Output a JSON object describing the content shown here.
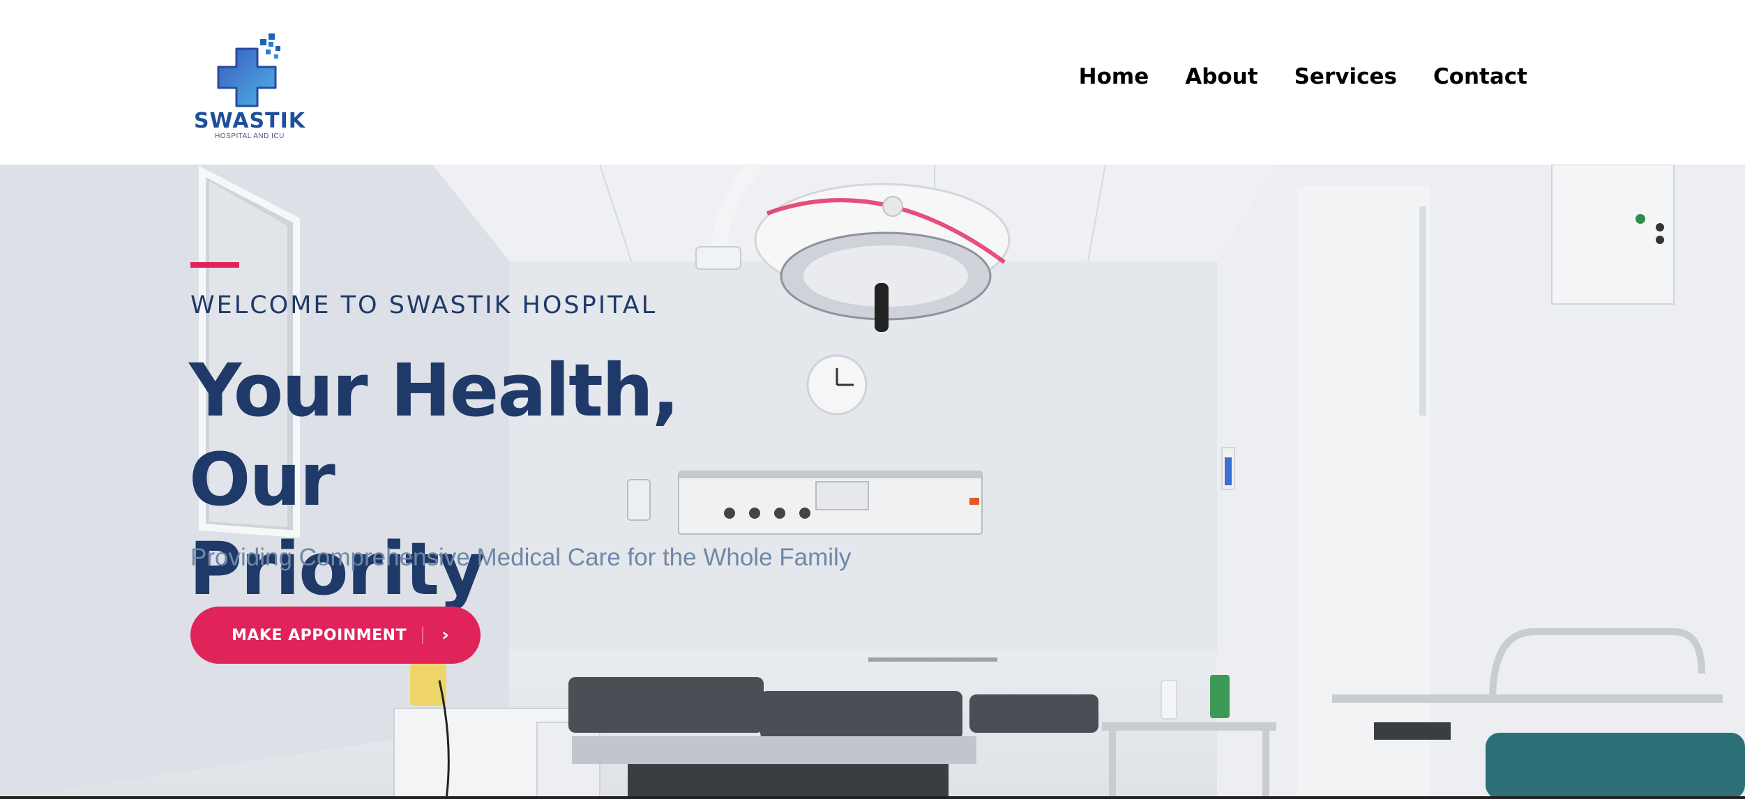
{
  "brand": {
    "name": "SWASTIK",
    "tagline": "HOSPITAL AND ICU",
    "colors": {
      "logo_blue": "#1d4f9c",
      "accent": "#e0245a",
      "heading": "#1f3a68"
    }
  },
  "nav": {
    "items": [
      {
        "label": "Home"
      },
      {
        "label": "About"
      },
      {
        "label": "Services"
      },
      {
        "label": "Contact"
      }
    ]
  },
  "hero": {
    "eyebrow": "WELCOME TO SWASTIK HOSPITAL",
    "headline_line1": "Your Health, Our",
    "headline_line2": "Priority",
    "subtitle": "Providing Comprehensive Medical Care for the Whole Family",
    "cta": {
      "label": "MAKE APPOINMENT",
      "icon": "chevron-right-icon"
    },
    "background": "operating-room-photo"
  }
}
